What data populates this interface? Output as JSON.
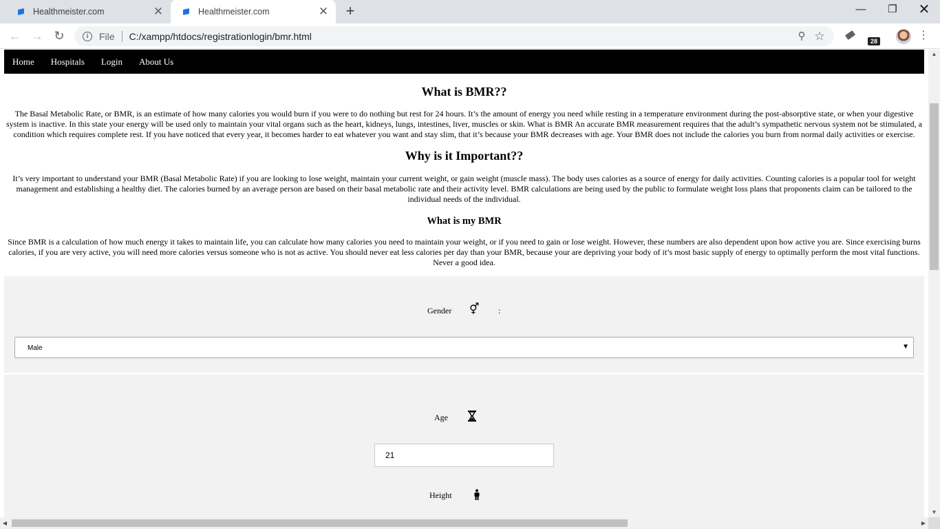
{
  "browser": {
    "tabs": [
      {
        "title": "Healthmeister.com",
        "active": false
      },
      {
        "title": "Healthmeister.com",
        "active": true
      }
    ],
    "new_tab_icon": "plus-icon",
    "scheme_label": "File",
    "url": "C:/xampp/htdocs/registrationlogin/bmr.html",
    "extension_badge": "28"
  },
  "nav": {
    "items": [
      "Home",
      "Hospitals",
      "Login",
      "About Us"
    ]
  },
  "sections": {
    "what_title": "What is BMR??",
    "what_text": "The Basal Metabolic Rate, or BMR, is an estimate of how many calories you would burn if you were to do nothing but rest for 24 hours. It’s the amount of energy you need while resting in a temperature environment during the post-absorptive state, or when your digestive system is inactive. In this state your energy will be used only to maintain your vital organs such as the heart, kidneys, lungs, intestines, liver, muscles or skin. What is BMR An accurate BMR measurement requires that the adult’s sympathetic nervous system not be stimulated, a condition which requires complete rest. If you have noticed that every year, it becomes harder to eat whatever you want and stay slim, that it’s because your BMR decreases with age. Your BMR does not include the calories you burn from normal daily activities or exercise.",
    "why_title": "Why is it Important??",
    "why_text": "It’s very important to understand your BMR (Basal Metabolic Rate) if you are looking to lose weight, maintain your current weight, or gain weight (muscle mass). The body uses calories as a source of energy for daily activities. Counting calories is a popular tool for weight management and establishing a healthy diet. The calories burned by an average person are based on their basal metabolic rate and their activity level. BMR calculations are being used by the public to formulate weight loss plans that proponents claim can be tailored to the individual needs of the individual.",
    "my_title": "What is my BMR",
    "my_text": "Since BMR is a calculation of how much energy it takes to maintain life, you can calculate how many calories you need to maintain your weight, or if you need to gain or lose weight. However, these numbers are also dependent upon how active you are. Since exercising burns calories, if you are very active, you will need more calories versus someone who is not as active. You should never eat less calories per day than your BMR, because your are depriving your body of it’s most basic supply of energy to optimally perform the most vital functions. Never a good idea."
  },
  "form": {
    "gender_label": "Gender",
    "gender_colon": ":",
    "gender_value": "Male",
    "age_label": "Age",
    "age_value": "21",
    "height_label": "Height"
  }
}
